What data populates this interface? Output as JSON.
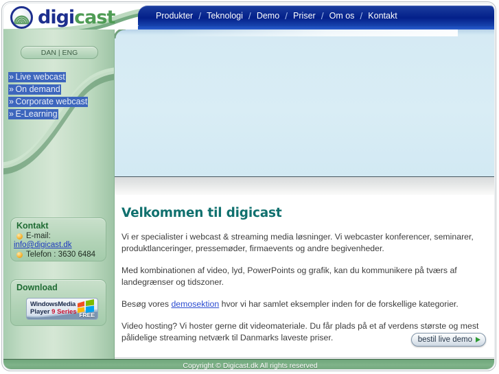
{
  "site": {
    "logo_text_part1": "digi",
    "logo_text_part2": "cast",
    "logo_icon": "broadcast-waves-icon"
  },
  "topnav": {
    "items": [
      {
        "label": "Produkter"
      },
      {
        "label": "Teknologi"
      },
      {
        "label": "Demo"
      },
      {
        "label": "Priser"
      },
      {
        "label": "Om os"
      },
      {
        "label": "Kontakt"
      }
    ],
    "separator": "/"
  },
  "sidebar": {
    "language_toggle": "DAN | ENG",
    "links": [
      {
        "chevron": "»",
        "label": "Live webcast"
      },
      {
        "chevron": "»",
        "label": "On demand"
      },
      {
        "chevron": "»",
        "label": "Corporate webcast"
      },
      {
        "chevron": "»",
        "label": "E-Learning"
      }
    ],
    "contact_box": {
      "title": "Kontakt",
      "email_label": "E-mail:",
      "email": "info@digicast.dk",
      "phone_label": "Telefon : 3630 6484"
    },
    "download_box": {
      "title": "Download",
      "badge_line1": "WindowsMedia",
      "badge_line2_a": "Player ",
      "badge_line2_b": "9 Series",
      "badge_free": "FREE"
    }
  },
  "content": {
    "heading": "Velkommen til digicast",
    "paragraph1": "Vi er specialister i webcast & streaming media løsninger. Vi webcaster konferencer, seminarer, produktlanceringer, pressemøder, firmaevents og andre begivenheder.",
    "paragraph2": "Med kombinationen af video, lyd, PowerPoints og grafik, kan du kommunikere på tværs af landegrænser og tidszoner.",
    "paragraph3_before": "Besøg vores ",
    "paragraph3_link": "demosektion",
    "paragraph3_after": " hvor vi har samlet eksempler inden for de forskellige kategorier.",
    "paragraph4": "Video hosting? Vi hoster gerne dit videomateriale. Du får plads på et af verdens største og mest pålidelige streaming netværk til Danmarks laveste priser.",
    "cta_button": "bestil live demo",
    "cta_arrow_icon": "play-triangle-icon"
  },
  "footer": {
    "copyright": "Copyright © Digicast.dk All rights reserved"
  },
  "colors": {
    "nav_blue": "#04208a",
    "sidebar_green": "#bcd9bf",
    "banner_blue": "#d9edf5",
    "heading_teal": "#10706e",
    "link_blue": "#2a4bd0",
    "footer_green": "#7fb389",
    "selection_blue": "#3d66bd",
    "accent_green": "#2f9b34"
  }
}
